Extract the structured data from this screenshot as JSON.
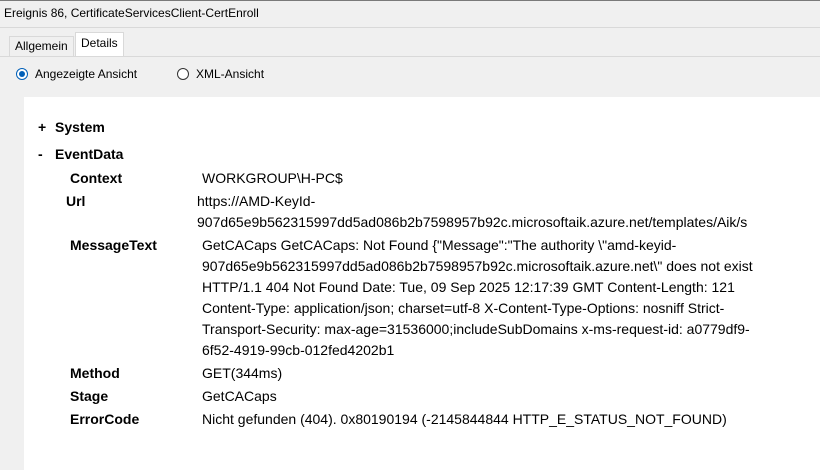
{
  "window": {
    "title": "Ereignis 86, CertificateServicesClient-CertEnroll"
  },
  "tabs": [
    {
      "label": "Allgemein",
      "selected": false
    },
    {
      "label": "Details",
      "selected": true
    }
  ],
  "view_options": {
    "friendly": {
      "label": "Angezeigte Ansicht",
      "checked": true
    },
    "xml": {
      "label": "XML-Ansicht",
      "checked": false
    }
  },
  "tree": {
    "system": {
      "sign": "+",
      "label": "System"
    },
    "eventdata": {
      "sign": "-",
      "label": "EventData"
    }
  },
  "fields": {
    "context": {
      "key": "Context",
      "value": "WORKGROUP\\H-PC$"
    },
    "url": {
      "key": "Url",
      "lines": [
        "https://AMD-KeyId-",
        "907d65e9b562315997dd5ad086b2b7598957b92c.microsoftaik.azure.net/templates/Aik/s"
      ]
    },
    "message": {
      "key": "MessageText",
      "lines": [
        "GetCACaps GetCACaps: Not Found {\"Message\":\"The authority \\\"amd-keyid-",
        "907d65e9b562315997dd5ad086b2b7598957b92c.microsoftaik.azure.net\\\" does not exist",
        "HTTP/1.1 404 Not Found Date: Tue, 09 Sep 2025 12:17:39 GMT Content-Length: 121",
        "Content-Type: application/json; charset=utf-8 X-Content-Type-Options: nosniff Strict-",
        "Transport-Security: max-age=31536000;includeSubDomains x-ms-request-id: a0779df9-",
        "6f52-4919-99cb-012fed4202b1"
      ]
    },
    "method": {
      "key": "Method",
      "value": "GET(344ms)"
    },
    "stage": {
      "key": "Stage",
      "value": "GetCACaps"
    },
    "errorcode": {
      "key": "ErrorCode",
      "value": "Nicht gefunden (404). 0x80190194 (-2145844844 HTTP_E_STATUS_NOT_FOUND)"
    }
  },
  "colors": {
    "accent": "#005fb8",
    "chrome": "#f0f0f0"
  }
}
